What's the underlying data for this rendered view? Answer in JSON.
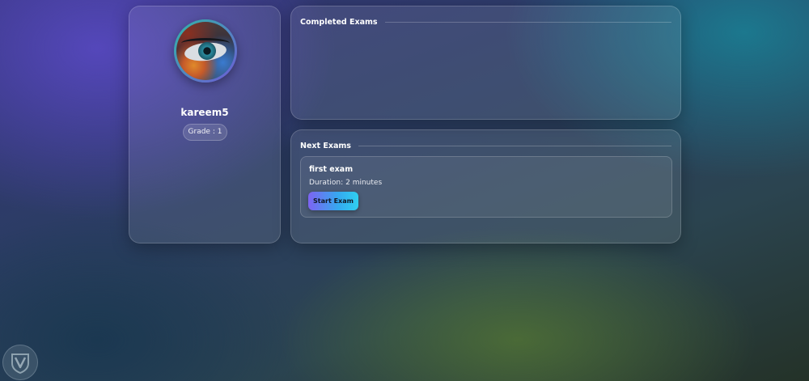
{
  "profile": {
    "username": "kareem5",
    "grade_label": "Grade : 1",
    "avatar_icon": "eye-photo-avatar"
  },
  "completed_exams": {
    "title": "Completed Exams",
    "items": []
  },
  "next_exams": {
    "title": "Next Exams",
    "items": [
      {
        "title": "first exam",
        "duration_label": "Duration:",
        "duration_value": "2 minutes",
        "button_label": "Start Exam"
      }
    ]
  },
  "corner_logo": {
    "icon": "v-shield-logo-icon"
  },
  "colors": {
    "button_gradient_start": "#7d63f2",
    "button_gradient_end": "#2fd0f0",
    "avatar_ring_start": "#2fb7a6",
    "avatar_ring_end": "#6f5ad8"
  }
}
